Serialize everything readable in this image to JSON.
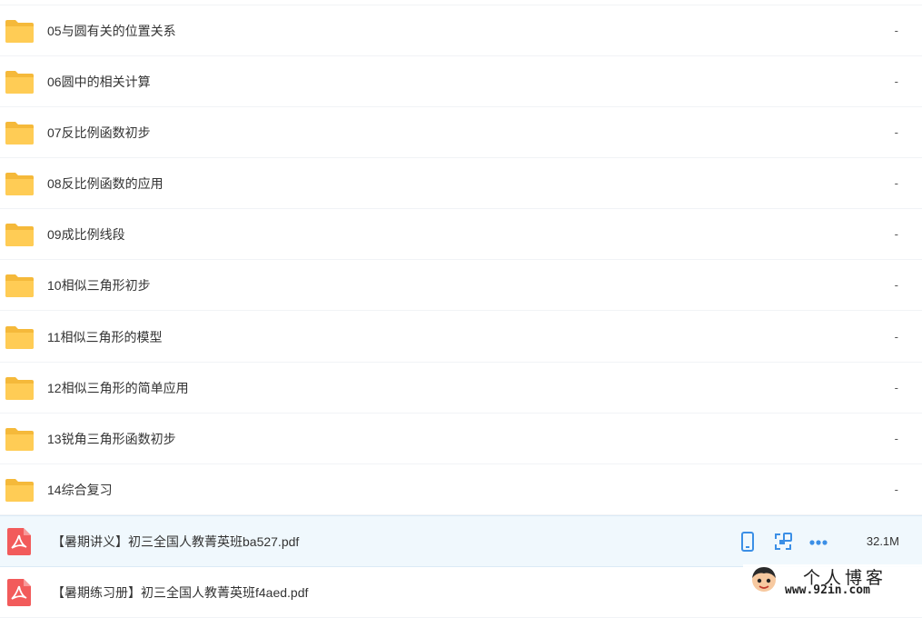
{
  "files": [
    {
      "type": "folder",
      "name": "05与圆有关的位置关系",
      "size": "-"
    },
    {
      "type": "folder",
      "name": "06圆中的相关计算",
      "size": "-"
    },
    {
      "type": "folder",
      "name": "07反比例函数初步",
      "size": "-"
    },
    {
      "type": "folder",
      "name": "08反比例函数的应用",
      "size": "-"
    },
    {
      "type": "folder",
      "name": "09成比例线段",
      "size": "-"
    },
    {
      "type": "folder",
      "name": "10相似三角形初步",
      "size": "-"
    },
    {
      "type": "folder",
      "name": "11相似三角形的模型",
      "size": "-"
    },
    {
      "type": "folder",
      "name": "12相似三角形的简单应用",
      "size": "-"
    },
    {
      "type": "folder",
      "name": "13锐角三角形函数初步",
      "size": "-"
    },
    {
      "type": "folder",
      "name": "14综合复习",
      "size": "-"
    },
    {
      "type": "pdf",
      "name": "【暑期讲义】初三全国人教菁英班ba527.pdf",
      "size": "32.1M",
      "selected": true
    },
    {
      "type": "pdf",
      "name": "【暑期练习册】初三全国人教菁英班f4aed.pdf",
      "size": ""
    }
  ],
  "row_actions": [
    "phone-icon",
    "share-icon",
    "more-icon"
  ],
  "watermark": {
    "title": "个人博客",
    "url": "www.92in.com"
  },
  "colors": {
    "folder": "#ffc94d",
    "pdf": "#f25b5b",
    "action": "#3b8fe6",
    "selected_bg": "#f0f8fd"
  }
}
